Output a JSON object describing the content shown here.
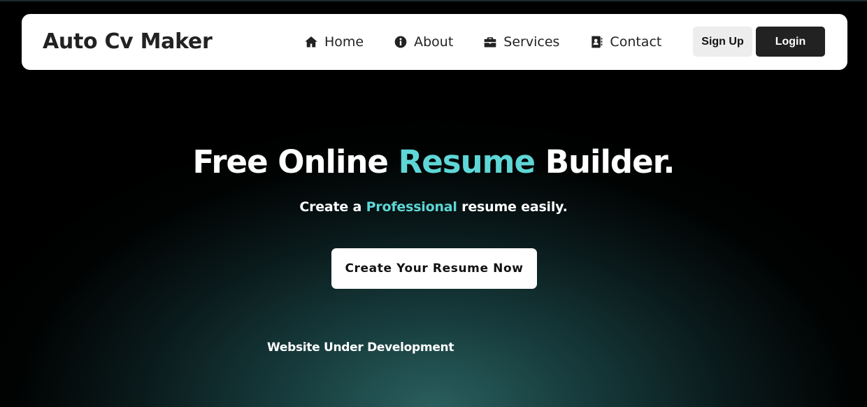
{
  "brand": {
    "name": "Auto Cv Maker"
  },
  "nav": {
    "items": [
      {
        "label": "Home",
        "icon": "home-icon"
      },
      {
        "label": "About",
        "icon": "info-icon"
      },
      {
        "label": "Services",
        "icon": "briefcase-icon"
      },
      {
        "label": "Contact",
        "icon": "address-book-icon"
      }
    ],
    "signup_label": "Sign Up",
    "login_label": "Login"
  },
  "hero": {
    "title_prefix": "Free Online ",
    "title_accent": "Resume",
    "title_suffix": " Builder.",
    "subtitle_prefix": "Create a ",
    "subtitle_accent": "Professional",
    "subtitle_suffix": " resume easily.",
    "cta_label": "Create Your Resume Now",
    "dev_note": "Website Under Development"
  },
  "colors": {
    "accent": "#5fd6d6",
    "navbar_bg": "#ffffff",
    "login_bg": "#222222",
    "signup_bg": "#ededed"
  }
}
